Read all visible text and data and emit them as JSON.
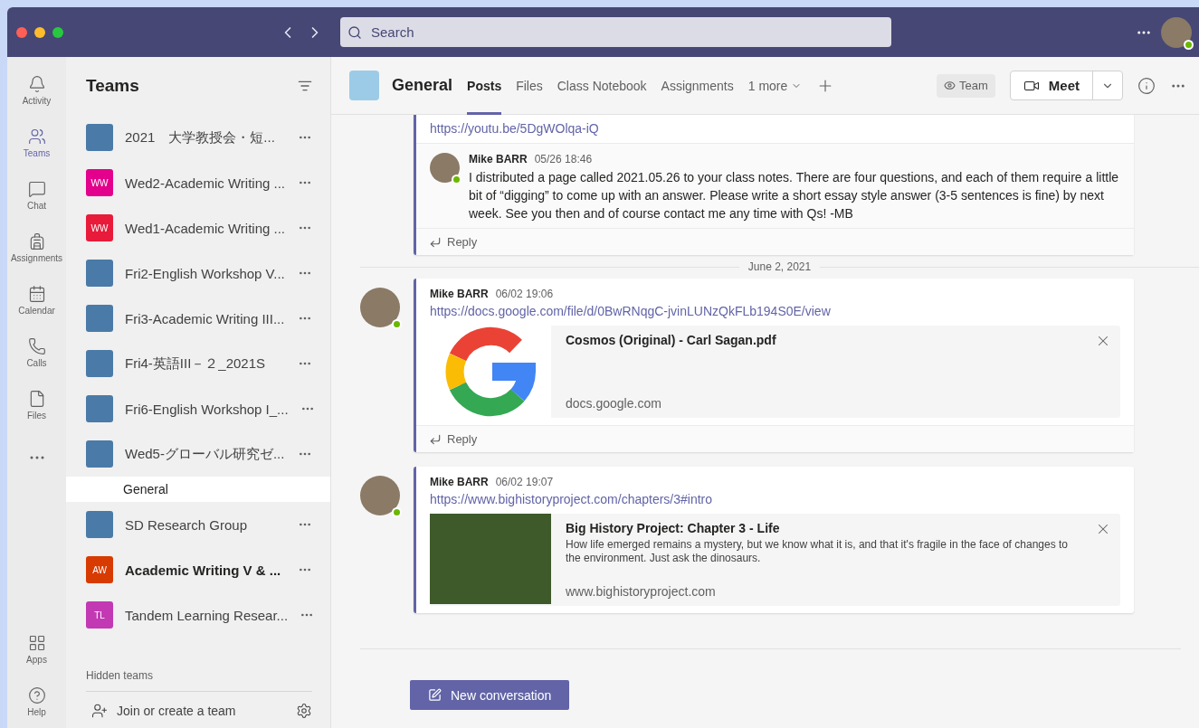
{
  "topbar": {
    "search": {
      "placeholder": "Search"
    }
  },
  "rail": {
    "items": [
      {
        "kind": "activity",
        "label": "Activity",
        "selected": false
      },
      {
        "kind": "teams",
        "label": "Teams",
        "selected": true
      },
      {
        "kind": "chat",
        "label": "Chat",
        "selected": false
      },
      {
        "kind": "assignments",
        "label": "Assignments",
        "selected": false
      },
      {
        "kind": "calendar",
        "label": "Calendar",
        "selected": false
      },
      {
        "kind": "calls",
        "label": "Calls",
        "selected": false
      },
      {
        "kind": "files",
        "label": "Files",
        "selected": false
      },
      {
        "kind": "more",
        "selected": false
      }
    ],
    "bottom": [
      {
        "kind": "apps",
        "label": "Apps"
      },
      {
        "kind": "help",
        "label": "Help"
      }
    ]
  },
  "teams_panel": {
    "title": "Teams",
    "teams": [
      {
        "name": "2021　大学教授会・短...",
        "kind": "picture",
        "unread": false
      },
      {
        "name": "Wed2-Academic Writing ...",
        "kind": "initials",
        "initials": "WW",
        "color": "#e3008c",
        "unread": false
      },
      {
        "name": "Wed1-Academic Writing ...",
        "kind": "initials",
        "initials": "WW",
        "color": "#e81b3a",
        "unread": false
      },
      {
        "name": "Fri2-English Workshop V...",
        "kind": "picture",
        "unread": false
      },
      {
        "name": "Fri3-Academic Writing III...",
        "kind": "picture",
        "unread": false
      },
      {
        "name": "Fri4-英語III－２_2021S",
        "kind": "picture",
        "unread": false
      },
      {
        "name": "Fri6-English Workshop I_...",
        "kind": "picture",
        "unread": false
      },
      {
        "name": "Wed5-グローバル研究ゼ...",
        "kind": "picture",
        "unread": false,
        "children": [
          {
            "name": "General",
            "selected": true
          }
        ]
      },
      {
        "name": "SD Research Group",
        "kind": "picture",
        "unread": false
      },
      {
        "name": "Academic Writing V & ...",
        "kind": "initials",
        "initials": "AW",
        "color": "#d83b01",
        "unread": true
      },
      {
        "name": "Tandem Learning Resear...",
        "kind": "initials",
        "initials": "TL",
        "color": "#c239b3",
        "unread": false
      }
    ],
    "hidden_label": "Hidden teams",
    "join": "Join or create a team"
  },
  "channel": {
    "title": "General",
    "tabs": [
      {
        "label": "Posts",
        "selected": true
      },
      {
        "label": "Files",
        "selected": false
      },
      {
        "label": "Class Notebook",
        "selected": false
      },
      {
        "label": "Assignments",
        "selected": false
      },
      {
        "label": "1 more",
        "selected": false
      }
    ],
    "team_button": "Team",
    "meet_button": "Meet"
  },
  "feed": [
    {
      "kind": "thread",
      "top_link": "https://youtu.be/5DgWOlqa-iQ",
      "reply": {
        "author": "Mike BARR",
        "time": "05/26 18:46",
        "text": "I distributed a page called 2021.05.26 to your class notes.  There are four questions, and each of them require a little bit of “digging” to come up with an answer. Please write a short essay style answer (3-5 sentences is fine) by next week.  See you then and of course contact me any time with Qs!  -MB"
      },
      "reply_label": "Reply"
    },
    {
      "kind": "divider",
      "text": "June 2, 2021"
    },
    {
      "kind": "post",
      "author": "Mike BARR",
      "time": "06/02 19:06",
      "link": "https://docs.google.com/file/d/0BwRNqgC-jvinLUNzQkFLb194S0E/view",
      "preview": {
        "kind": "document",
        "title": "Cosmos (Original) - Carl Sagan.pdf",
        "domain": "docs.google.com"
      },
      "reply_label": "Reply"
    },
    {
      "kind": "post",
      "author": "Mike BARR",
      "time": "06/02 19:07",
      "link": "https://www.bighistoryproject.com/chapters/3#intro",
      "preview": {
        "kind": "article",
        "title": "Big History Project: Chapter 3 - Life",
        "description": "How life emerged remains a mystery, but we know what it is, and that it's fragile in the face of changes to the environment. Just ask the dinosaurs.",
        "domain": "www.bighistoryproject.com"
      }
    }
  ],
  "new_conversation": "New conversation"
}
